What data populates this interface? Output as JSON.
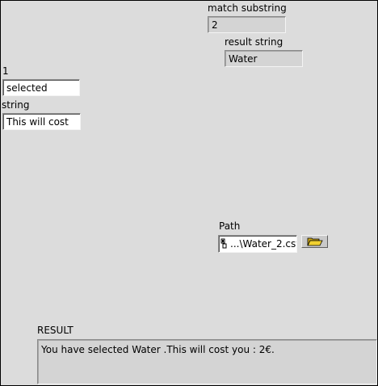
{
  "match_substring": {
    "label": "match substring",
    "value": "2"
  },
  "result_string": {
    "label": "result string",
    "value": "Water"
  },
  "control_1": {
    "label": "1",
    "value": "selected"
  },
  "control_string": {
    "label": "string",
    "value": "This will cost"
  },
  "path": {
    "label": "Path",
    "value": "...\\Water_2.csv",
    "icon": "path-file-icon",
    "browse_icon": "folder-open-icon"
  },
  "result": {
    "label": "RESULT",
    "value": "You have selected Water .This will cost you : 2€."
  },
  "colors": {
    "panel": "#dcdcdc",
    "indicator": "#d4d4d4",
    "control": "#ffffff",
    "folder": "#e8c020"
  }
}
